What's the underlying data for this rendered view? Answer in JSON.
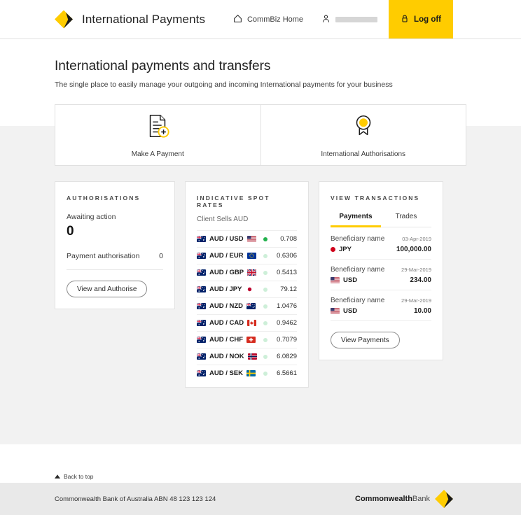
{
  "header": {
    "app_title": "International Payments",
    "commbiz_home": "CommBiz Home",
    "username": "",
    "logoff": "Log off",
    "accent": "#ffcc00"
  },
  "page": {
    "title": "International payments and transfers",
    "subtitle": "The single place to easily manage your outgoing and incoming International payments for your business"
  },
  "actions": [
    {
      "label": "Make A Payment",
      "icon": "document-plus-icon"
    },
    {
      "label": "International Authorisations",
      "icon": "medal-ribbon-icon"
    }
  ],
  "authorisations": {
    "title": "AUTHORISATIONS",
    "awaiting_label": "Awaiting action",
    "awaiting_count": "0",
    "row_label": "Payment authorisation",
    "row_count": "0",
    "button": "View and Authorise"
  },
  "spot_rates": {
    "title": "INDICATIVE SPOT RATES",
    "subtitle": "Client Sells AUD",
    "rows": [
      {
        "pair": "AUD / USD",
        "flag": "us-flag",
        "rate": "0.708",
        "dot": "#22b14c"
      },
      {
        "pair": "AUD / EUR",
        "flag": "eu-flag",
        "rate": "0.6306",
        "dot": "#cdefd8"
      },
      {
        "pair": "AUD / GBP",
        "flag": "gb-flag",
        "rate": "0.5413",
        "dot": "#cdefd8"
      },
      {
        "pair": "AUD / JPY",
        "flag": "jp-flag",
        "rate": "79.12",
        "dot": "#cdefd8"
      },
      {
        "pair": "AUD / NZD",
        "flag": "nz-flag",
        "rate": "1.0476",
        "dot": "#cdefd8"
      },
      {
        "pair": "AUD / CAD",
        "flag": "ca-flag",
        "rate": "0.9462",
        "dot": "#cdefd8"
      },
      {
        "pair": "AUD / CHF",
        "flag": "ch-flag",
        "rate": "0.7079",
        "dot": "#cdefd8"
      },
      {
        "pair": "AUD / NOK",
        "flag": "no-flag",
        "rate": "6.0829",
        "dot": "#cdefd8"
      },
      {
        "pair": "AUD / SEK",
        "flag": "se-flag",
        "rate": "6.5661",
        "dot": "#cdefd8"
      }
    ]
  },
  "transactions": {
    "title": "VIEW TRANSACTIONS",
    "tabs": [
      {
        "label": "Payments",
        "active": true
      },
      {
        "label": "Trades",
        "active": false
      }
    ],
    "rows": [
      {
        "beneficiary": "Beneficiary name",
        "date": "03-Apr-2019",
        "currency": "JPY",
        "flag": "jp-flag",
        "amount": "100,000.00"
      },
      {
        "beneficiary": "Beneficiary name",
        "date": "29-Mar-2019",
        "currency": "USD",
        "flag": "us-flag",
        "amount": "234.00"
      },
      {
        "beneficiary": "Beneficiary name",
        "date": "29-Mar-2019",
        "currency": "USD",
        "flag": "us-flag",
        "amount": "10.00"
      }
    ],
    "button": "View Payments"
  },
  "footer": {
    "back_to_top": "Back to top",
    "legal": "Commonwealth Bank of Australia ABN 48 123 123 124",
    "logo_bold": "Commonwealth",
    "logo_light": "Bank"
  }
}
